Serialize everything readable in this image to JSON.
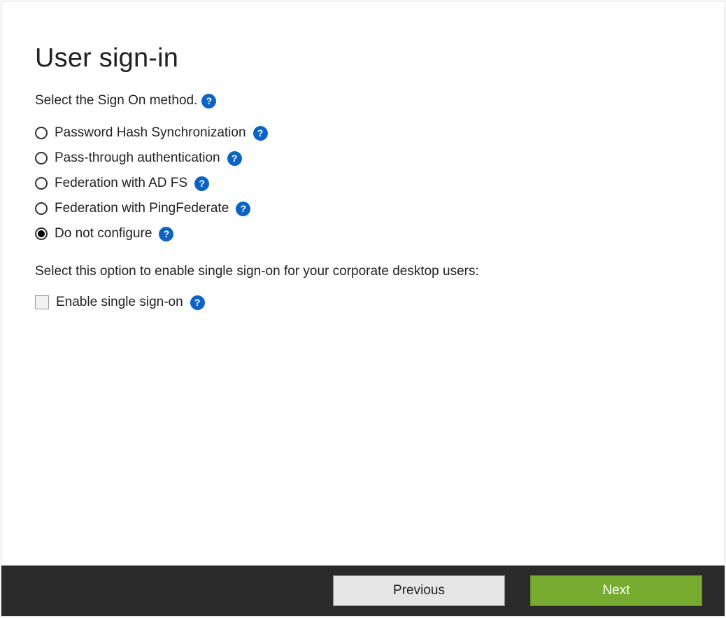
{
  "page": {
    "title": "User sign-in",
    "instruction": "Select the Sign On method."
  },
  "options": [
    {
      "label": "Password Hash Synchronization",
      "selected": false
    },
    {
      "label": "Pass-through authentication",
      "selected": false
    },
    {
      "label": "Federation with AD FS",
      "selected": false
    },
    {
      "label": "Federation with PingFederate",
      "selected": false
    },
    {
      "label": "Do not configure",
      "selected": true
    }
  ],
  "sso": {
    "description": "Select this option to enable single sign-on for your corporate desktop users:",
    "checkbox_label": "Enable single sign-on",
    "checked": false
  },
  "footer": {
    "previous": "Previous",
    "next": "Next"
  },
  "help_glyph": "?"
}
